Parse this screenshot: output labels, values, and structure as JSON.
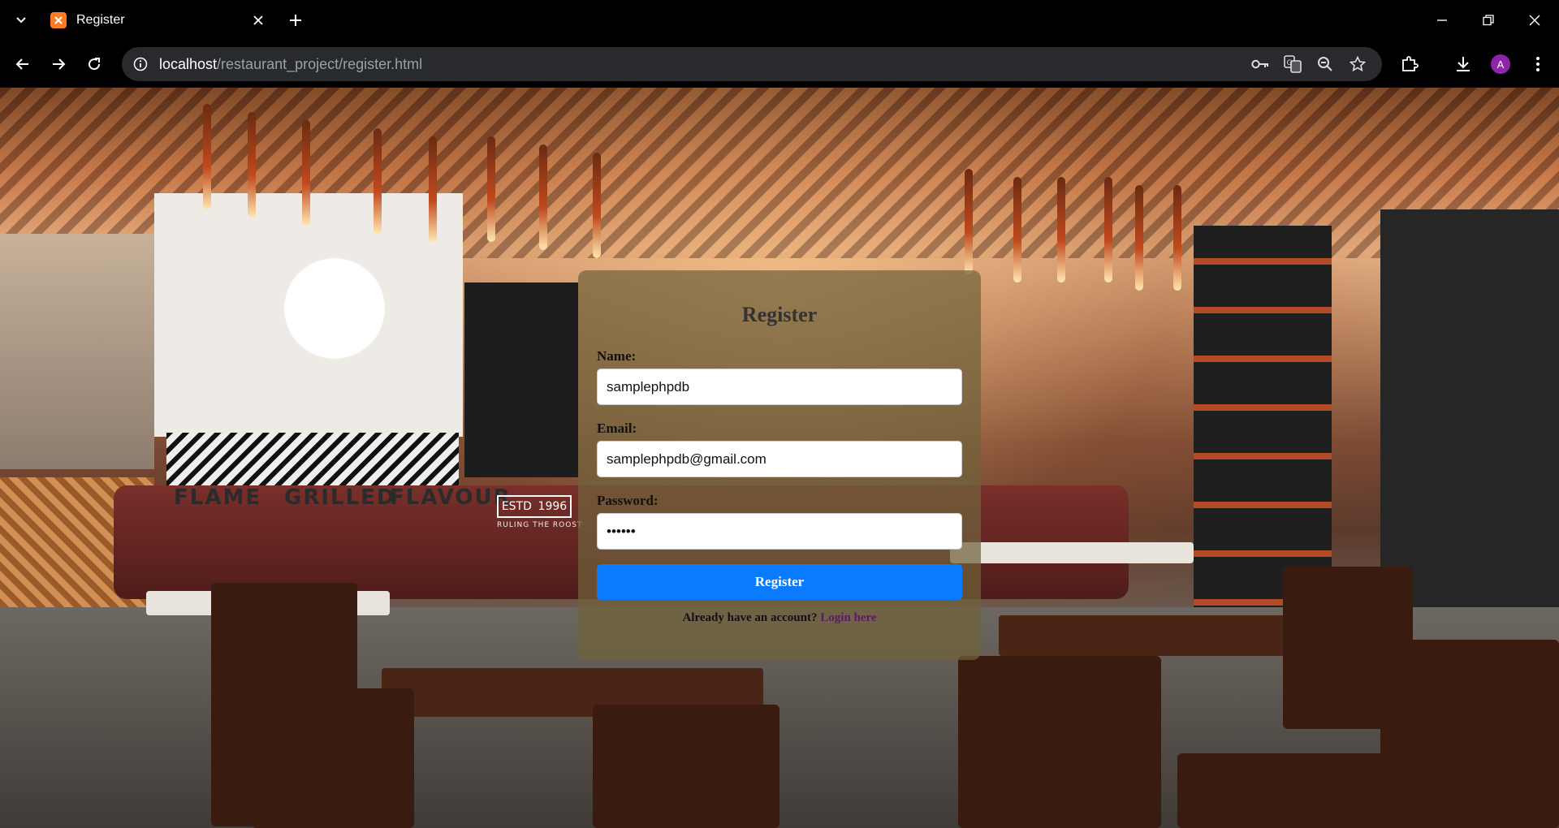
{
  "browser": {
    "tab": {
      "title": "Register"
    },
    "address_bar": {
      "host": "localhost",
      "path": "/restaurant_project/register.html"
    },
    "profile_initial": "A"
  },
  "background": {
    "brand_words": [
      "FLAME",
      "GRILLED",
      "FLAVOUR"
    ],
    "badge_estd": "ESTD",
    "badge_year": "1996",
    "badge_motto": "RULING THE ROOST"
  },
  "form": {
    "title": "Register",
    "name_label": "Name:",
    "name_value": "samplephpdb",
    "email_label": "Email:",
    "email_value": "samplephpdb@gmail.com",
    "password_label": "Password:",
    "password_value": "••••••",
    "submit_label": "Register",
    "login_prompt": "Already have an account?",
    "login_link": "Login here"
  },
  "colors": {
    "accent_button": "#0a7bff",
    "card": "rgba(112,98,60,0.72)",
    "link": "#5a1a66",
    "avatar": "#8e24aa"
  }
}
